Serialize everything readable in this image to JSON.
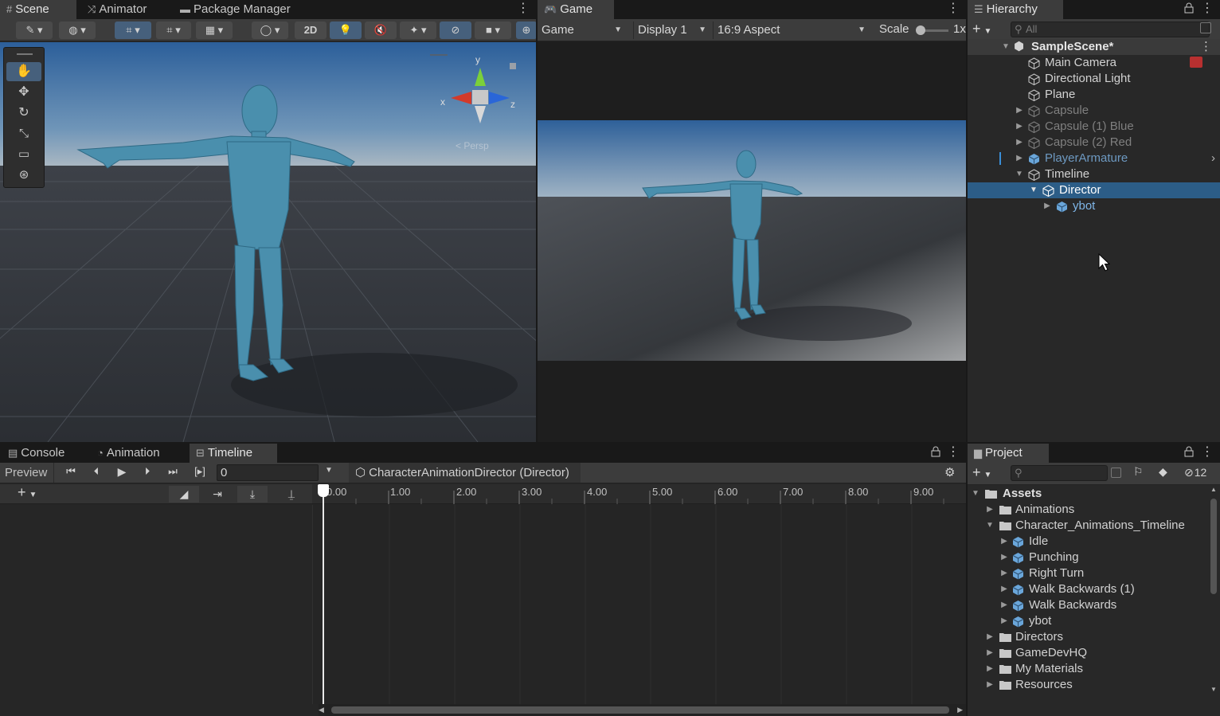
{
  "scene_panel": {
    "tabs": [
      "Scene",
      "Animator",
      "Package Manager"
    ],
    "toolbar": {
      "btn_2d": "2D"
    },
    "tools": [
      "hand-tool",
      "move-tool",
      "rotate-tool",
      "scale-tool",
      "rect-tool",
      "transform-tool"
    ],
    "gizmo": {
      "y": "y",
      "x": "x",
      "z": "z",
      "projection": "< Persp"
    }
  },
  "game_panel": {
    "tab": "Game",
    "toolbar": {
      "mode": "Game",
      "display": "Display 1",
      "aspect": "16:9 Aspect",
      "scale_label": "Scale",
      "scale_value": "1x"
    }
  },
  "hierarchy": {
    "tab": "Hierarchy",
    "search_placeholder": "All",
    "scene": "SampleScene*",
    "items": [
      {
        "label": "Main Camera"
      },
      {
        "label": "Directional Light"
      },
      {
        "label": "Plane"
      },
      {
        "label": "Capsule"
      },
      {
        "label": "Capsule (1) Blue"
      },
      {
        "label": "Capsule (2) Red"
      },
      {
        "label": "PlayerArmature"
      },
      {
        "label": "Timeline"
      },
      {
        "label": "Director"
      },
      {
        "label": "ybot"
      }
    ]
  },
  "bottom_panel": {
    "tabs": [
      "Console",
      "Animation",
      "Timeline"
    ],
    "preview_label": "Preview",
    "frame_value": "0",
    "breadcrumb": "CharacterAnimationDirector (Director)",
    "ruler": [
      "0.00",
      "1.00",
      "2.00",
      "3.00",
      "4.00",
      "5.00",
      "6.00",
      "7.00",
      "8.00",
      "9.00"
    ]
  },
  "project": {
    "tab": "Project",
    "hidden_count": "12",
    "root": "Assets",
    "items": [
      {
        "label": "Animations"
      },
      {
        "label": "Character_Animations_Timeline"
      },
      {
        "label": "Idle"
      },
      {
        "label": "Punching"
      },
      {
        "label": "Right Turn"
      },
      {
        "label": "Walk Backwards (1)"
      },
      {
        "label": "Walk Backwards"
      },
      {
        "label": "ybot"
      },
      {
        "label": "Directors"
      },
      {
        "label": "GameDevHQ"
      },
      {
        "label": "My Materials"
      },
      {
        "label": "Resources"
      }
    ]
  },
  "colors": {
    "selection": "#2c5d87",
    "accent_prefab": "#7fb6e8",
    "panel": "#282828",
    "toolbar": "#3c3c3c"
  }
}
